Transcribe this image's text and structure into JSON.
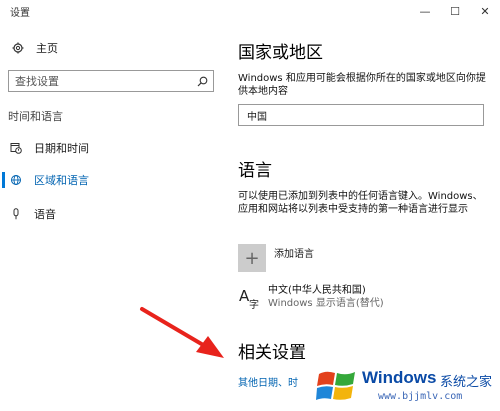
{
  "window": {
    "title": "设置",
    "controls": [
      "—",
      "☐",
      "✕"
    ]
  },
  "sidebar": {
    "home": "主页",
    "search_placeholder": "查找设置",
    "section": "时间和语言",
    "items": [
      {
        "label": "日期和时间",
        "icon": "calendar-clock-icon",
        "active": false
      },
      {
        "label": "区域和语言",
        "icon": "region-language-icon",
        "active": true
      },
      {
        "label": "语音",
        "icon": "microphone-icon",
        "active": false
      }
    ]
  },
  "main": {
    "country": {
      "heading": "国家或地区",
      "description": "Windows 和应用可能会根据你所在的国家或地区向你提供本地内容",
      "value": "中国"
    },
    "language": {
      "heading": "语言",
      "description": "可以使用已添加到列表中的任何语言键入。Windows、应用和网站将以列表中受支持的第一种语言进行显示",
      "add_label": "添加语言",
      "installed": {
        "name": "中文(中华人民共和国)",
        "sub": "Windows 显示语言(替代)"
      }
    },
    "related": {
      "heading": "相关设置",
      "link": "其他日期、时"
    }
  },
  "watermark": {
    "brand": "Windows",
    "brand2": "系统之家",
    "url": "www.bjjmlv.com"
  },
  "colors": {
    "accent": "#0078d7",
    "link": "#0063b1",
    "arrow": "#e8231c"
  }
}
